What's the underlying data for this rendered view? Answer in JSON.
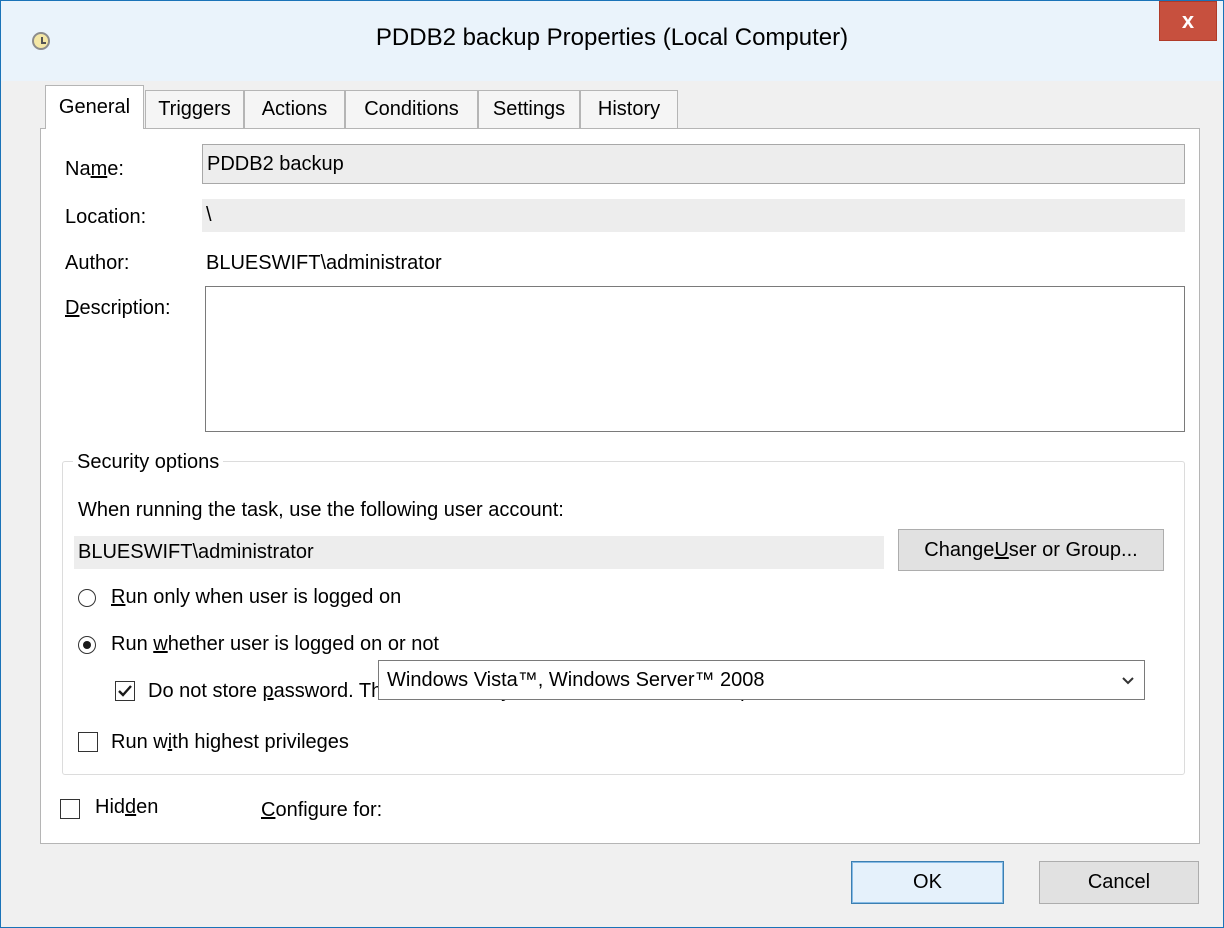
{
  "window": {
    "title": "PDDB2 backup Properties (Local Computer)",
    "close_glyph": "x"
  },
  "tabs": [
    {
      "label": "General",
      "active": true
    },
    {
      "label": "Triggers"
    },
    {
      "label": "Actions"
    },
    {
      "label": "Conditions"
    },
    {
      "label": "Settings"
    },
    {
      "label": "History"
    }
  ],
  "general": {
    "name_label_pre": "Na",
    "name_label_u": "m",
    "name_label_post": "e:",
    "name_value": "PDDB2 backup",
    "location_label": "Location:",
    "location_value": "\\",
    "author_label": "Author:",
    "author_value": "BLUESWIFT\\administrator",
    "description_label_u": "D",
    "description_label_post": "escription:",
    "description_value": ""
  },
  "security": {
    "title": "Security options",
    "account_prompt": "When running the task, use the following user account:",
    "account_value": "BLUESWIFT\\administrator",
    "change_button_pre": "Change ",
    "change_button_u": "U",
    "change_button_post": "ser or Group...",
    "radio_logged_on_u": "R",
    "radio_logged_on_post": "un only when user is logged on",
    "radio_logged_on_checked": false,
    "radio_whether_pre": "Run ",
    "radio_whether_u": "w",
    "radio_whether_post": "hether user is logged on or not",
    "radio_whether_checked": true,
    "no_store_pre": "Do not store ",
    "no_store_u": "p",
    "no_store_post": "assword.  The task will only have access to local computer resources.",
    "no_store_checked": true,
    "highest_pre": "Run w",
    "highest_u": "i",
    "highest_post": "th highest privileges",
    "highest_checked": false
  },
  "bottom": {
    "hidden_pre": "Hid",
    "hidden_u": "d",
    "hidden_post": "en",
    "hidden_checked": false,
    "configure_u": "C",
    "configure_post": "onfigure for:",
    "configure_value": "Windows Vista™, Windows Server™ 2008"
  },
  "footer": {
    "ok_label": "OK",
    "cancel_label": "Cancel"
  },
  "icons": {
    "app": "task-scheduler-clock-icon",
    "close": "close-icon",
    "dropdown": "chevron-down-icon",
    "check": "checkmark-icon"
  }
}
